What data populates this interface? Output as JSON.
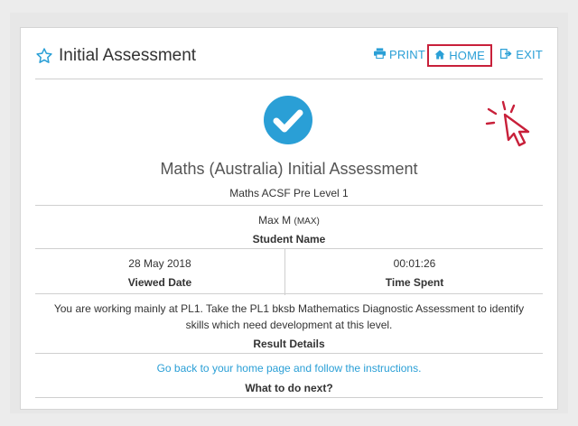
{
  "header": {
    "title": "Initial Assessment",
    "nav": {
      "print": "PRINT",
      "home": "HOME",
      "exit": "EXIT"
    }
  },
  "assessment": {
    "title": "Maths (Australia) Initial Assessment",
    "subtitle": "Maths ACSF Pre Level 1"
  },
  "student": {
    "name": "Max M",
    "username": "(MAX)",
    "label": "Student Name"
  },
  "viewed": {
    "value": "28 May 2018",
    "label": "Viewed Date"
  },
  "time": {
    "value": "00:01:26",
    "label": "Time Spent"
  },
  "result": {
    "line1": "You are working mainly at PL1. Take the PL1 bksb Mathematics Diagnostic Assessment to identify",
    "line2": "skills which need development at this level.",
    "label": "Result Details"
  },
  "next": {
    "text": "Go back to your home page and follow the instructions.",
    "label": "What to do next?"
  },
  "colors": {
    "accent": "#2a9fd6",
    "highlight": "#c8203a",
    "check": "#2a9fd6"
  },
  "icons": [
    "star-outline-icon",
    "print-icon",
    "home-icon",
    "exit-icon",
    "check-circle-icon",
    "hand-pointer-cursor-icon"
  ]
}
